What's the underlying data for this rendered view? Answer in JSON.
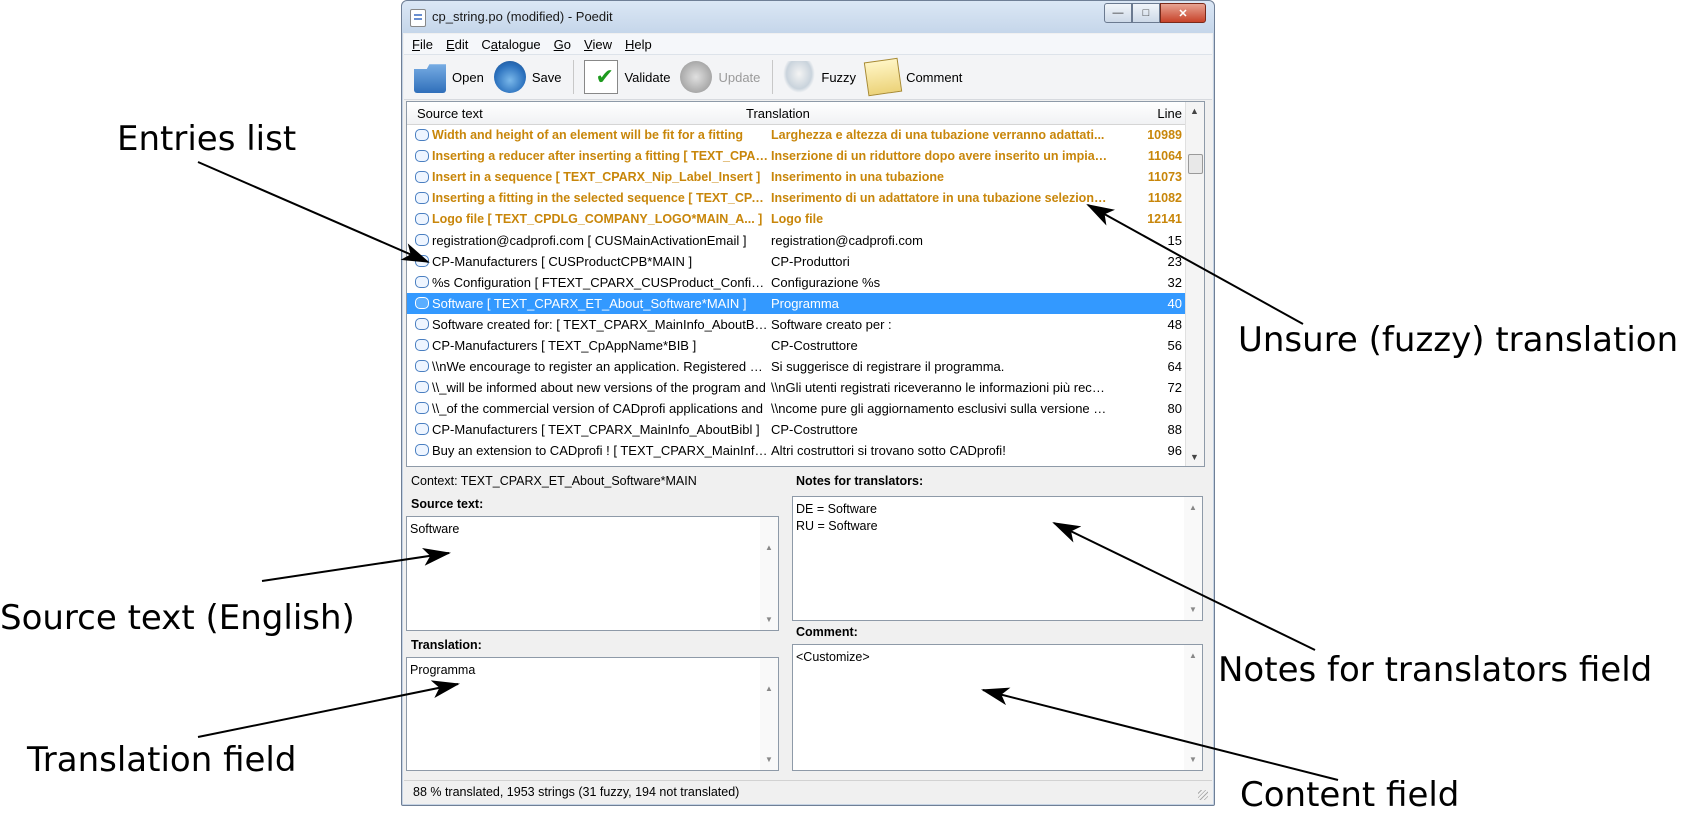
{
  "window": {
    "title": "cp_string.po (modified) - Poedit",
    "buttons": [
      "minimize",
      "maximize",
      "close"
    ]
  },
  "menu": [
    {
      "label": "File",
      "accel": "F",
      "rest": "ile"
    },
    {
      "label": "Edit",
      "accel": "E",
      "rest": "dit"
    },
    {
      "label": "Catalogue",
      "accel": "a",
      "pre": "C",
      "rest": "talogue"
    },
    {
      "label": "Go",
      "accel": "G",
      "rest": "o"
    },
    {
      "label": "View",
      "accel": "V",
      "rest": "iew"
    },
    {
      "label": "Help",
      "accel": "H",
      "rest": "elp"
    }
  ],
  "toolbar": {
    "open": "Open",
    "save": "Save",
    "validate": "Validate",
    "update": "Update",
    "fuzzy": "Fuzzy",
    "comment": "Comment"
  },
  "list": {
    "headers": {
      "source": "Source text",
      "translation": "Translation",
      "line": "Line"
    },
    "rows": [
      {
        "source": "Width and height of an element will be fit for a fitting",
        "translation": "Larghezza e altezza di una tubazione verranno adattati...",
        "line": "10989",
        "state": "fuzzy"
      },
      {
        "source": "Inserting a reducer after inserting a fitting  [ TEXT_CPARX_",
        "translation": "Inserzione di un riduttore dopo avere inserito un impianto",
        "line": "11064",
        "state": "fuzzy"
      },
      {
        "source": "Insert in a sequence  [ TEXT_CPARX_Nip_Label_Insert ]",
        "translation": "Inserimento in una tubazione",
        "line": "11073",
        "state": "fuzzy"
      },
      {
        "source": "Inserting a fitting in the selected sequence  [ TEXT_CPARX ]",
        "translation": "Inserimento di un adattatore in una tubazione selezionata",
        "line": "11082",
        "state": "fuzzy"
      },
      {
        "source": "Logo file  [ TEXT_CPDLG_COMPANY_LOGO*MAIN_A... ]",
        "translation": "Logo file",
        "line": "12141",
        "state": "fuzzy"
      },
      {
        "source": "registration@cadprofi.com  [ CUSMainActivationEmail ]",
        "translation": "registration@cadprofi.com",
        "line": "15",
        "state": "normal"
      },
      {
        "source": "CP-Manufacturers  [ CUSProductCPB*MAIN ]",
        "translation": "CP-Produttori",
        "line": "23",
        "state": "normal"
      },
      {
        "source": "%s Configuration  [ FTEXT_CPARX_CUSProduct_Configuration ]",
        "translation": "Configurazione %s",
        "line": "32",
        "state": "normal"
      },
      {
        "source": "Software  [ TEXT_CPARX_ET_About_Software*MAIN ]",
        "translation": "Programma",
        "line": "40",
        "state": "selected"
      },
      {
        "source": "Software created for:  [ TEXT_CPARX_MainInfo_AboutBib ]",
        "translation": "Software creato per :",
        "line": "48",
        "state": "normal"
      },
      {
        "source": "CP-Manufacturers  [ TEXT_CpAppName*BIB ]",
        "translation": "CP-Costruttore",
        "line": "56",
        "state": "normal"
      },
      {
        "source": "\\\\nWe encourage to register an application. Registered users",
        "translation": "Si suggerisce di registrare il programma.",
        "line": "64",
        "state": "normal"
      },
      {
        "source": "\\\\_will be informed about new versions of the program and",
        "translation": "\\\\nGli utenti registrati riceveranno le informazioni più recenti",
        "line": "72",
        "state": "normal"
      },
      {
        "source": "\\\\_of the commercial version of CADprofi applications and",
        "translation": "\\\\ncome pure gli aggiornamento esclusivi sulla versione commerciale",
        "line": "80",
        "state": "normal"
      },
      {
        "source": "CP-Manufacturers  [ TEXT_CPARX_MainInfo_AboutBibl ]",
        "translation": "CP-Costruttore",
        "line": "88",
        "state": "normal"
      },
      {
        "source": "Buy an extension to CADprofi !  [ TEXT_CPARX_MainInfo ]",
        "translation": "Altri costruttori si trovano sotto CADprofi!",
        "line": "96",
        "state": "normal"
      }
    ]
  },
  "details": {
    "context": "Context: TEXT_CPARX_ET_About_Software*MAIN",
    "source_label": "Source text:",
    "source_value": "Software",
    "translation_label": "Translation:",
    "translation_value": "Programma",
    "notes_label": "Notes for translators:",
    "notes_value": "DE = Software\nRU = Software",
    "comment_label": "Comment:",
    "comment_value": "<Customize>"
  },
  "status": "88 % translated, 1953 strings (31 fuzzy, 194 not translated)",
  "callouts": {
    "entries_list": "Entries list",
    "fuzzy": "Unsure (fuzzy) translation",
    "source": "Source text (English)",
    "notes": "Notes for translators field",
    "translation": "Translation field",
    "content": "Content field"
  }
}
